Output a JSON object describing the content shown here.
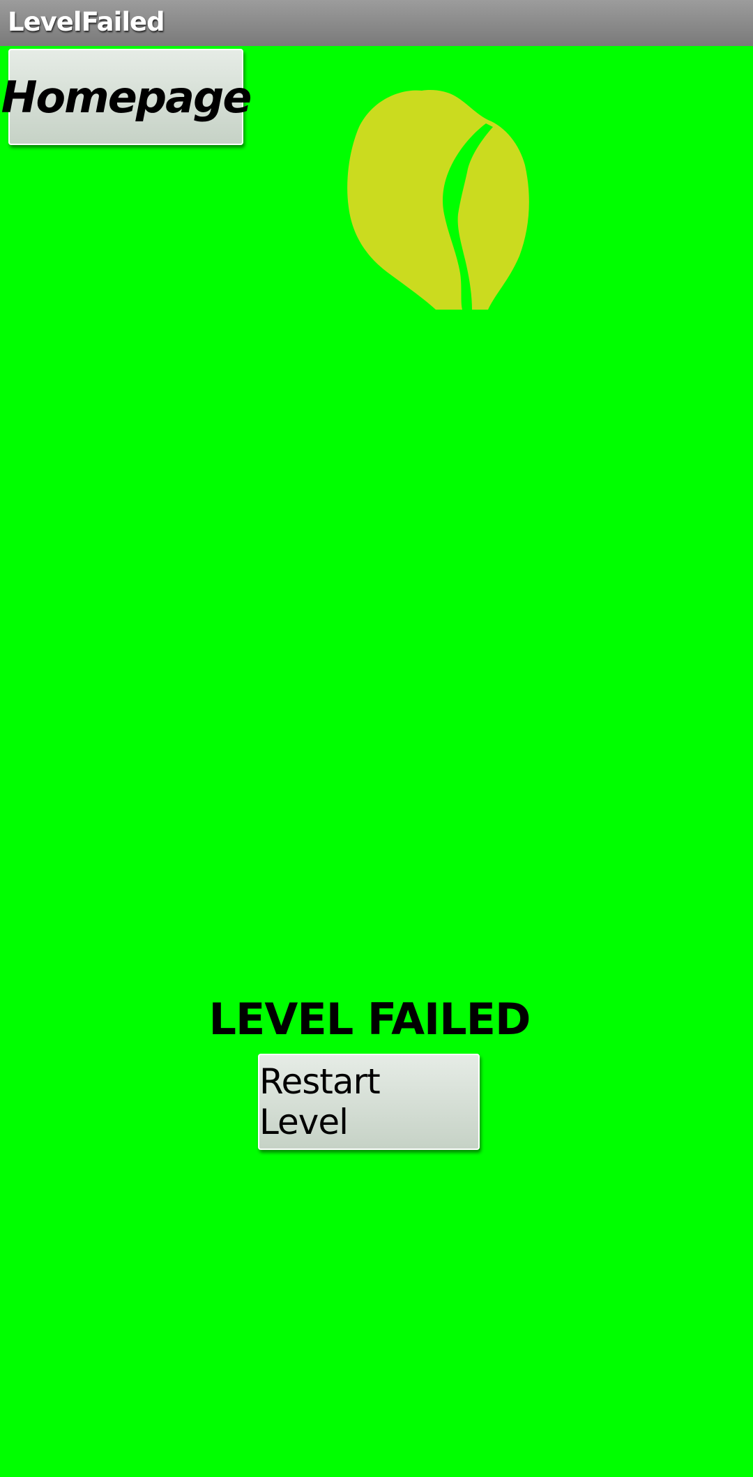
{
  "app": {
    "title": "LevelFailed"
  },
  "top": {
    "homepage_label": "Homepage"
  },
  "main": {
    "headline": "LEVEL FAILED",
    "restart_label": "Restart Level"
  },
  "colors": {
    "background": "#00ff00",
    "titlebar": "#8a8a8a",
    "logo_fill": "#cbdb1f"
  },
  "icons": {
    "logo": "fruit-logo-icon"
  }
}
